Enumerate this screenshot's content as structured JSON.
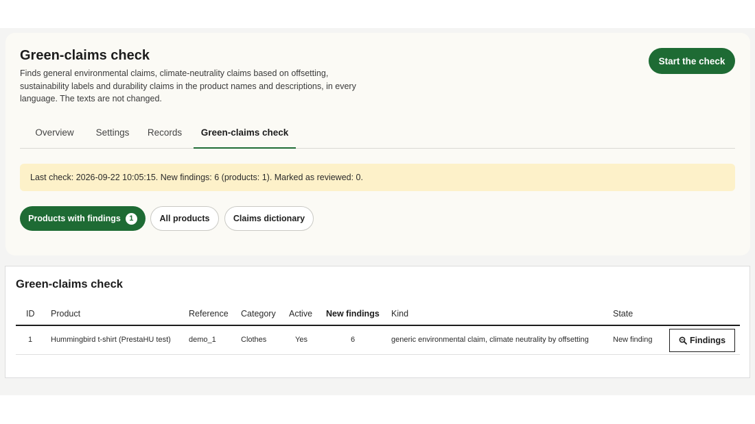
{
  "header": {
    "title": "Green-claims check",
    "description": "Finds general environmental claims, climate-neutrality claims based on offsetting, sustainability labels and durability claims in the product names and descriptions, in every language. The texts are not changed.",
    "start_button": "Start the check"
  },
  "tabs": [
    {
      "label": "Overview"
    },
    {
      "label": "Settings"
    },
    {
      "label": "Records"
    },
    {
      "label": "Green-claims check",
      "active": true
    }
  ],
  "notice": "Last check: 2026-09-22 10:05:15. New findings: 6 (products: 1). Marked as reviewed: 0.",
  "filters": {
    "products_with_findings": "Products with findings",
    "products_with_findings_count": "1",
    "all_products": "All products",
    "claims_dictionary": "Claims dictionary"
  },
  "table": {
    "title": "Green-claims check",
    "headers": {
      "id": "ID",
      "product": "Product",
      "reference": "Reference",
      "category": "Category",
      "active": "Active",
      "new_findings": "New findings",
      "kind": "Kind",
      "state": "State"
    },
    "rows": [
      {
        "id": "1",
        "product": "Hummingbird t-shirt (PrestaHU test)",
        "reference": "demo_1",
        "category": "Clothes",
        "active": "Yes",
        "new_findings": "6",
        "kind": "generic environmental claim, climate neutrality by offsetting",
        "state": "New finding",
        "action": "Findings"
      }
    ]
  },
  "colors": {
    "accent_green": "#1e6b34",
    "notice_bg": "#fdf1c9"
  },
  "icons": {
    "findings_button_icon": "magnifier-icon"
  }
}
